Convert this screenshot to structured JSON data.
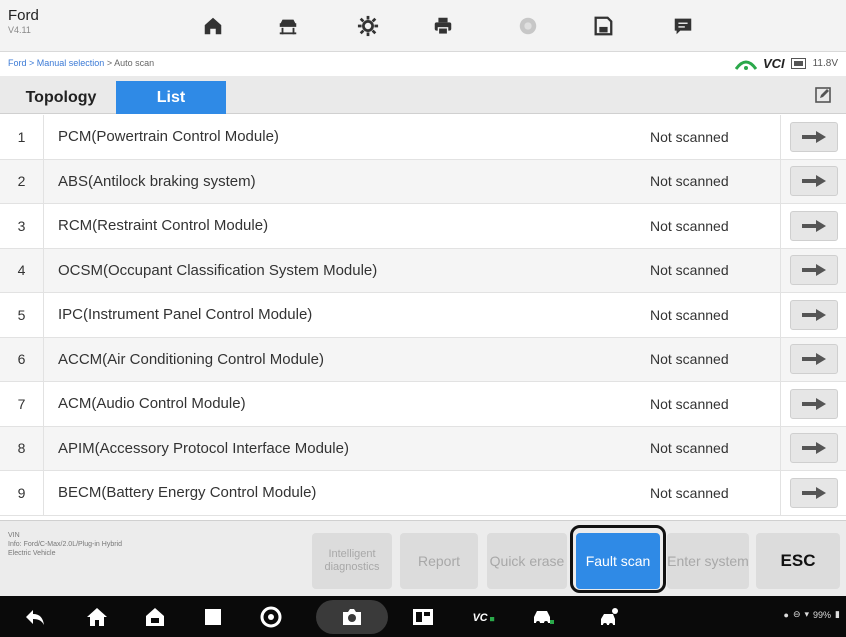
{
  "app": {
    "brand": "Ford",
    "version": "V4.11"
  },
  "toolbar": {
    "icons": [
      "home-icon",
      "vehicle-lift-icon",
      "gear-icon",
      "printer-icon",
      "camera-icon",
      "save-icon",
      "message-icon"
    ]
  },
  "breadcrumb": {
    "link": "Ford > Manual selection",
    "current": " > Auto scan"
  },
  "status": {
    "vci": "VCI",
    "voltage": "11.8V"
  },
  "tabs": [
    {
      "label": "Topology",
      "active": false
    },
    {
      "label": "List",
      "active": true
    }
  ],
  "modules": [
    {
      "num": "1",
      "name": "PCM(Powertrain Control Module)",
      "status": "Not scanned"
    },
    {
      "num": "2",
      "name": "ABS(Antilock braking system)",
      "status": "Not scanned"
    },
    {
      "num": "3",
      "name": "RCM(Restraint Control Module)",
      "status": "Not scanned"
    },
    {
      "num": "4",
      "name": "OCSM(Occupant Classification System Module)",
      "status": "Not scanned"
    },
    {
      "num": "5",
      "name": "IPC(Instrument Panel Control Module)",
      "status": "Not scanned"
    },
    {
      "num": "6",
      "name": "ACCM(Air Conditioning Control Module)",
      "status": "Not scanned"
    },
    {
      "num": "7",
      "name": "ACM(Audio Control Module)",
      "status": "Not scanned"
    },
    {
      "num": "8",
      "name": "APIM(Accessory Protocol Interface Module)",
      "status": "Not scanned"
    },
    {
      "num": "9",
      "name": "BECM(Battery Energy Control Module)",
      "status": "Not scanned"
    }
  ],
  "vehicle_info": {
    "line1": "VIN",
    "line2": "Info: Ford/C-Max/2.0L/Plug-in Hybrid",
    "line3": "Electric Vehicle"
  },
  "actions": {
    "intelligent": "Intelligent diagnostics",
    "report": "Report",
    "quick_erase": "Quick erase",
    "fault_scan": "Fault scan",
    "enter_system": "Enter system",
    "esc": "ESC"
  },
  "tray": {
    "battery": "99%"
  },
  "colors": {
    "accent": "#2f8ae6",
    "vci_green": "#2aa84a"
  }
}
